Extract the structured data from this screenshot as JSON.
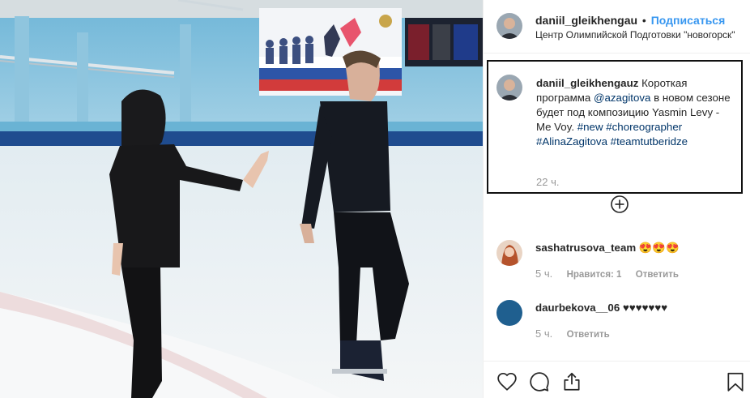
{
  "post": {
    "author": "daniil_gleikhengauz",
    "author_truncated": "daniil_gleikhengau",
    "separator": "•",
    "follow_label": "Подписаться",
    "location": "Центр Олимпийской Подготовки \"новогорск\""
  },
  "caption": {
    "username": "daniil_gleikhengauz",
    "text_1": "Короткая программа",
    "mention": "@azagitova",
    "text_2": "в новом сезоне будет под композицию Yasmin Levy - Me Voy.",
    "tag_1": "#new",
    "tag_2": "#choreographer",
    "tag_3": "#AlinaZagitova",
    "tag_4": "#teamtutberidze",
    "time": "22 ч."
  },
  "comments": [
    {
      "username": "sashatrusova_team",
      "text": "😍😍😍",
      "time": "5 ч.",
      "likes_label": "Нравится: 1",
      "reply_label": "Ответить"
    },
    {
      "username": "daurbekova__06",
      "text": "♥♥♥♥♥♥♥",
      "time": "5 ч.",
      "reply_label": "Ответить"
    }
  ],
  "icons": {
    "load_more": "plus-circle-icon",
    "like": "heart-icon",
    "comment": "comment-bubble-icon",
    "share": "share-icon",
    "save": "bookmark-icon"
  },
  "colors": {
    "follow": "#3897f0",
    "link": "#003569",
    "muted": "#999999",
    "commenter2_avatar": "#1f5f8f"
  }
}
